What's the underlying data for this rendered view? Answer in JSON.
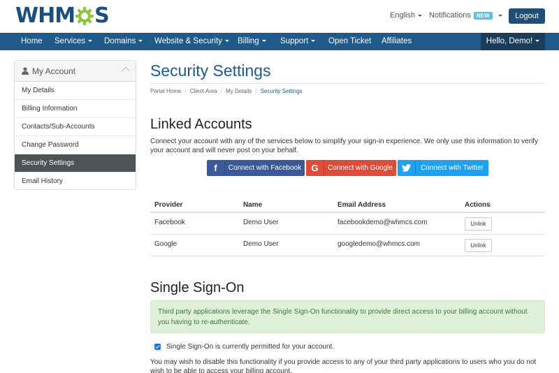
{
  "header": {
    "logo_text_left": "WHM",
    "logo_text_right": "S",
    "language": "English",
    "notifications": "Notifications",
    "notifications_badge": "NEW",
    "logout": "Logout"
  },
  "nav": {
    "items": [
      {
        "label": "Home",
        "dropdown": false
      },
      {
        "label": "Services",
        "dropdown": true
      },
      {
        "label": "Domains",
        "dropdown": true
      },
      {
        "label": "Website & Security",
        "dropdown": true
      },
      {
        "label": "Billing",
        "dropdown": true
      },
      {
        "label": "Support",
        "dropdown": true
      },
      {
        "label": "Open Ticket",
        "dropdown": false
      },
      {
        "label": "Affiliates",
        "dropdown": false
      }
    ],
    "greeting": "Hello, Demo!"
  },
  "sidebar": {
    "title": "My Account",
    "items": [
      {
        "label": "My Details"
      },
      {
        "label": "Billing Information"
      },
      {
        "label": "Contacts/Sub-Accounts"
      },
      {
        "label": "Change Password"
      },
      {
        "label": "Security Settings",
        "active": true
      },
      {
        "label": "Email History"
      }
    ]
  },
  "page": {
    "title": "Security Settings",
    "breadcrumb": [
      "Portal Home",
      "Client Area",
      "My Details",
      "Security Settings"
    ]
  },
  "linked": {
    "heading": "Linked Accounts",
    "intro": "Connect your account with any of the services below to simplify your sign-in experience. We only use this information to verify your account and will never post on your behalf.",
    "buttons": {
      "facebook": "Connect with Facebook",
      "google": "Connect with Google",
      "twitter": "Connect with Twitter"
    },
    "columns": [
      "Provider",
      "Name",
      "Email Address",
      "Actions"
    ],
    "rows": [
      {
        "provider": "Facebook",
        "name": "Demo User",
        "email": "facebookdemo@whmcs.com",
        "action": "Unlink"
      },
      {
        "provider": "Google",
        "name": "Demo User",
        "email": "googledemo@whmcs.com",
        "action": "Unlink"
      }
    ]
  },
  "sso": {
    "heading": "Single Sign-On",
    "alert": "Third party applications leverage the Single Sign-On functionality to provide direct access to your billing account without you having to re-authenticate.",
    "checkbox_label": "Single Sign-On is currently permitted for your account.",
    "checkbox_checked": true,
    "note": "You may wish to disable this functionality if you provide access to any of your third party applications to users who you do not wish to be able to access your billing account."
  },
  "colors": {
    "brand": "#1f5a8a",
    "facebook": "#3b5998",
    "google": "#dd4b39",
    "twitter": "#1da1f2"
  }
}
